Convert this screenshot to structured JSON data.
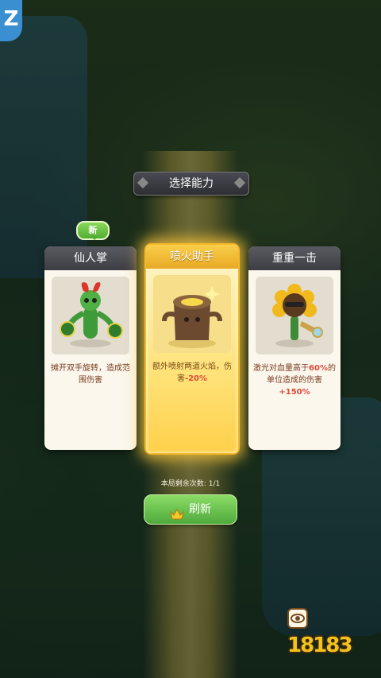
{
  "header": {
    "title": "选择能力"
  },
  "badges": {
    "new": "新"
  },
  "cards": [
    {
      "name": "仙人掌",
      "desc_pre": "摊开双手旋转，造成范围伤害",
      "desc_hl1": "",
      "desc_mid": "",
      "desc_hl2": ""
    },
    {
      "name": "喷火助手",
      "desc_pre": "额外喷射两道火焰，伤害",
      "desc_hl1": "-20%",
      "desc_mid": "",
      "desc_hl2": ""
    },
    {
      "name": "重重一击",
      "desc_pre": "激光对血量高于",
      "desc_hl1": "60%",
      "desc_mid": "的单位造成的伤害",
      "desc_hl2": "+150%"
    }
  ],
  "remaining": {
    "label": "本局剩余次数:",
    "value": "1/1"
  },
  "refresh": {
    "label": "刷新"
  },
  "watermark": {
    "text": "18183"
  },
  "colors": {
    "accent_gold": "#f3b92a",
    "button_green": "#4faa3c",
    "highlight_red": "#e04a3a"
  }
}
